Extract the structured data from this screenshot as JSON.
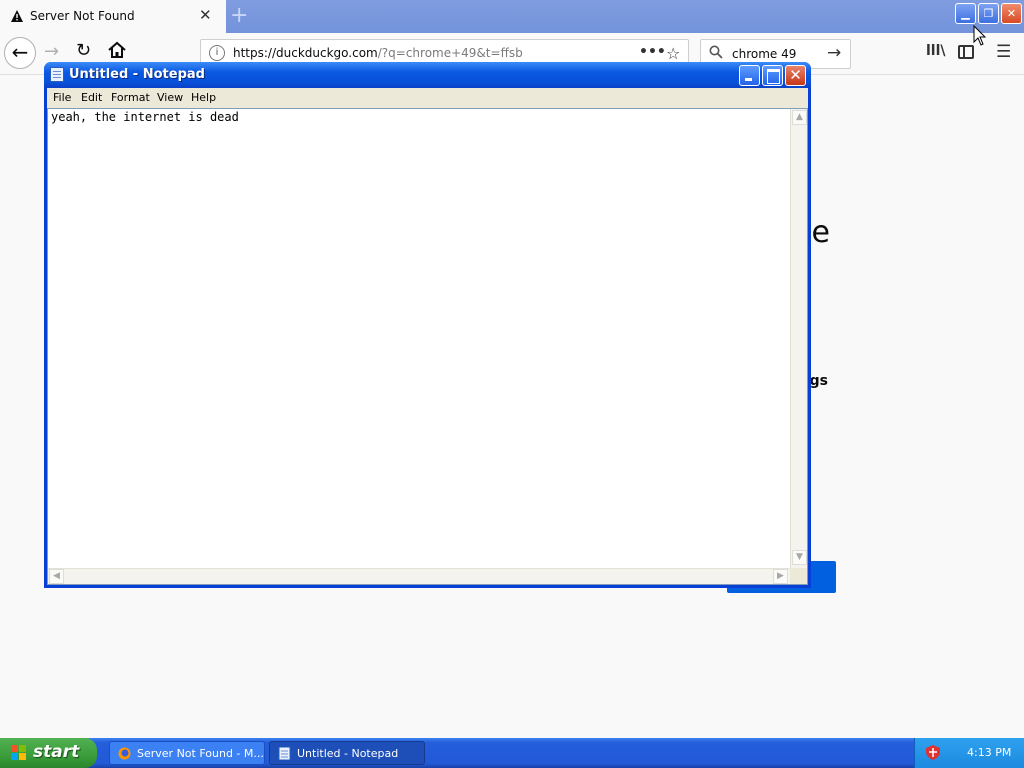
{
  "browser": {
    "tab": {
      "title": "Server Not Found",
      "close": "✕"
    },
    "new_tab": "+",
    "url_host": "https://duckduckgo.com",
    "url_rest": "/?q=chrome+49&t=ffsb",
    "page_actions": "•••",
    "bookmark": "☆",
    "search_query": "chrome 49",
    "search_go": "→",
    "nav": {
      "back": "←",
      "forward": "→",
      "reload": "↻"
    },
    "library": "lll\\",
    "menu": "☰",
    "window_controls": {
      "minimize": "▁",
      "restore": "❐",
      "close": "✕"
    },
    "page": {
      "heading_fragment": "e",
      "sub_fragment": "gs"
    }
  },
  "notepad": {
    "title": "Untitled - Notepad",
    "menu": [
      "File",
      "Edit",
      "Format",
      "View",
      "Help"
    ],
    "content": "yeah, the internet is dead",
    "close_glyph": "✕",
    "scroll_up": "▲",
    "scroll_down": "▼",
    "scroll_left": "◀",
    "scroll_right": "▶"
  },
  "taskbar": {
    "start_label": "start",
    "tasks": [
      {
        "label": "Server Not Found - M...",
        "active": false
      },
      {
        "label": "Untitled - Notepad",
        "active": true
      }
    ],
    "clock": "4:13 PM"
  },
  "colors": {
    "xp_title_blue": "#0b58e2",
    "firefox_tabstrip": "#7f9ce0",
    "taskbar_blue": "#245edb",
    "start_green": "#3a9c3a",
    "ddg_button_blue": "#0060df"
  },
  "icons": [
    "warning-icon",
    "home-icon",
    "info-icon",
    "search-icon",
    "notepad-icon",
    "windows-flag-icon",
    "firefox-icon",
    "security-shield-icon",
    "mouse-cursor-icon"
  ]
}
